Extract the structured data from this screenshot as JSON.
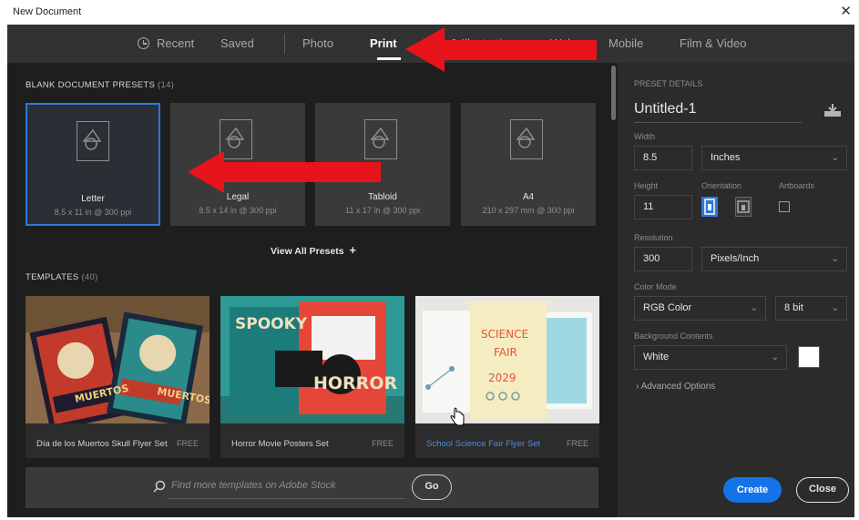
{
  "window": {
    "title": "New Document",
    "close_glyph": "✕"
  },
  "tabs": [
    {
      "label": "Recent",
      "icon": "clock-icon"
    },
    {
      "label": "Saved"
    },
    {
      "label": "Photo"
    },
    {
      "label": "Print",
      "active": true
    },
    {
      "label": "Art & Illustration"
    },
    {
      "label": "Web"
    },
    {
      "label": "Mobile"
    },
    {
      "label": "Film & Video"
    }
  ],
  "presets_section": {
    "title": "BLANK DOCUMENT PRESETS",
    "count": "(14)"
  },
  "presets": [
    {
      "name": "Letter",
      "size": "8.5 x 11 in @ 300 ppi",
      "selected": true
    },
    {
      "name": "Legal",
      "size": "8.5 x 14 in @ 300 ppi"
    },
    {
      "name": "Tabloid",
      "size": "11 x 17 in @ 300 ppi"
    },
    {
      "name": "A4",
      "size": "210 x 297 mm @ 300 ppi"
    }
  ],
  "view_all": {
    "label": "View All Presets",
    "icon": "plus-icon",
    "glyph": "+"
  },
  "templates_section": {
    "title": "TEMPLATES",
    "count": "(40)"
  },
  "templates": [
    {
      "name": "Día de los Muertos Skull Flyer Set",
      "badge": "FREE",
      "thumb_text": "MUERTOS"
    },
    {
      "name": "Horror Movie Posters Set",
      "badge": "FREE",
      "thumb_text": [
        "SPOOKY",
        "HORROR"
      ]
    },
    {
      "name": "School Science Fair Flyer Set",
      "badge": "FREE",
      "thumb_text": [
        "SCIENCE",
        "FAIR",
        "2029"
      ],
      "hovered": true
    }
  ],
  "stock_search": {
    "placeholder": "Find more templates on Adobe Stock",
    "go_label": "Go"
  },
  "preset_details": {
    "header": "PRESET DETAILS",
    "doc_name": "Untitled-1",
    "width_label": "Width",
    "width_value": "8.5",
    "width_unit": "Inches",
    "height_label": "Height",
    "height_value": "11",
    "orientation_label": "Orientation",
    "artboards_label": "Artboards",
    "resolution_label": "Resolution",
    "resolution_value": "300",
    "resolution_unit": "Pixels/Inch",
    "color_mode_label": "Color Mode",
    "color_mode_value": "RGB Color",
    "bit_depth": "8 bit",
    "background_label": "Background Contents",
    "background_value": "White",
    "advanced_label": "Advanced Options",
    "create_label": "Create",
    "close_label": "Close"
  },
  "colors": {
    "accent": "#1473e6",
    "selection_border": "#2d78d9",
    "annotation_arrow": "#e8141b",
    "link": "#4a8fe0"
  }
}
